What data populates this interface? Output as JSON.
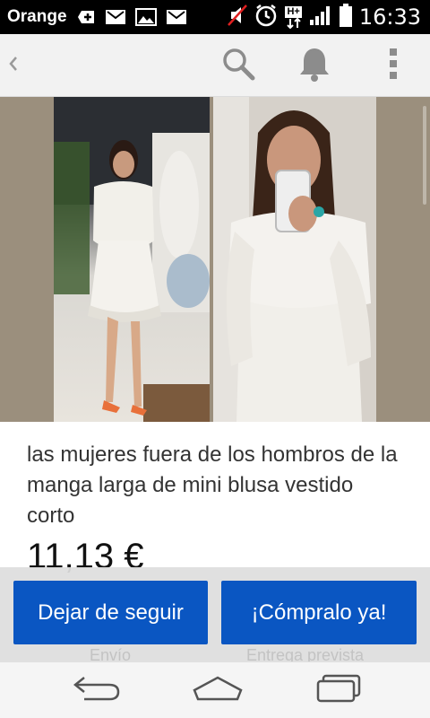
{
  "status_bar": {
    "carrier": "Orange",
    "network": "H+",
    "time": "16:33"
  },
  "toolbar": {
    "back_icon": "chevron-left-icon",
    "search_icon": "search-icon",
    "notifications_icon": "bell-icon",
    "more_icon": "overflow-menu-icon"
  },
  "product": {
    "title": "las mujeres fuera de los hombros de la manga larga de mini blusa vestido corto",
    "price": "11,13 €"
  },
  "actions": {
    "unfollow_label": "Dejar de seguir",
    "buy_label": "¡Cómpralo ya!",
    "shipping_label": "Envío",
    "delivery_label": "Entrega prevista"
  },
  "nav": {
    "back_icon": "back-arrow-icon",
    "home_icon": "home-icon",
    "recent_icon": "recent-apps-icon"
  },
  "colors": {
    "primary_button": "#0a56c2",
    "status_bar": "#000000",
    "toolbar": "#f2f2f2"
  }
}
